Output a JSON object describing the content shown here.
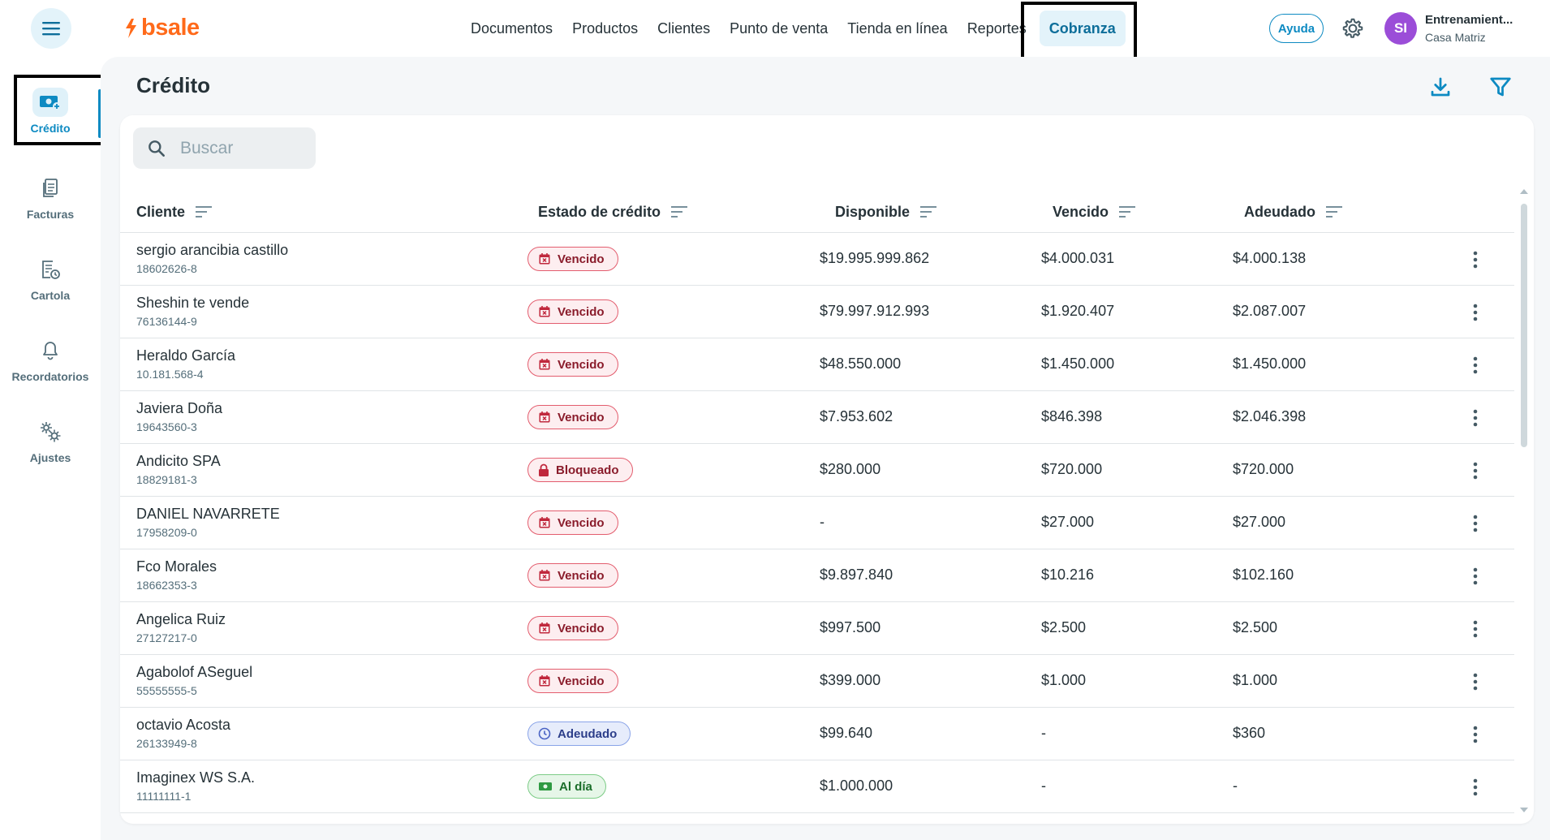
{
  "nav": {
    "logo_text": "bsale",
    "items": [
      {
        "label": "Documentos"
      },
      {
        "label": "Productos"
      },
      {
        "label": "Clientes"
      },
      {
        "label": "Punto de venta"
      },
      {
        "label": "Tienda en línea"
      },
      {
        "label": "Reportes"
      },
      {
        "label": "Cobranza",
        "active": true
      }
    ],
    "help_label": "Ayuda",
    "user": {
      "initials": "SI",
      "name": "Entrenamient...",
      "branch": "Casa Matriz"
    }
  },
  "sidebar": {
    "items": [
      {
        "label": "Crédito",
        "icon": "money-icon",
        "active": true
      },
      {
        "label": "Facturas",
        "icon": "document-icon"
      },
      {
        "label": "Cartola",
        "icon": "statement-icon"
      },
      {
        "label": "Recordatorios",
        "icon": "bell-icon"
      },
      {
        "label": "Ajustes",
        "icon": "settings-gears-icon"
      }
    ]
  },
  "page": {
    "title": "Crédito",
    "search_placeholder": "Buscar"
  },
  "table": {
    "columns": [
      "Cliente",
      "Estado de crédito",
      "Disponible",
      "Vencido",
      "Adeudado"
    ],
    "rows": [
      {
        "name": "sergio arancibia castillo",
        "rut": "18602626-8",
        "status": "Vencido",
        "status_type": "vencido",
        "disponible": "$19.995.999.862",
        "vencido": "$4.000.031",
        "adeudado": "$4.000.138"
      },
      {
        "name": "Sheshin te vende",
        "rut": "76136144-9",
        "status": "Vencido",
        "status_type": "vencido",
        "disponible": "$79.997.912.993",
        "vencido": "$1.920.407",
        "adeudado": "$2.087.007"
      },
      {
        "name": "Heraldo García",
        "rut": "10.181.568-4",
        "status": "Vencido",
        "status_type": "vencido",
        "disponible": "$48.550.000",
        "vencido": "$1.450.000",
        "adeudado": "$1.450.000"
      },
      {
        "name": "Javiera Doña",
        "rut": "19643560-3",
        "status": "Vencido",
        "status_type": "vencido",
        "disponible": "$7.953.602",
        "vencido": "$846.398",
        "adeudado": "$2.046.398"
      },
      {
        "name": "Andicito SPA",
        "rut": "18829181-3",
        "status": "Bloqueado",
        "status_type": "bloqueado",
        "disponible": "$280.000",
        "vencido": "$720.000",
        "adeudado": "$720.000"
      },
      {
        "name": "DANIEL NAVARRETE",
        "rut": "17958209-0",
        "status": "Vencido",
        "status_type": "vencido",
        "disponible": "-",
        "vencido": "$27.000",
        "adeudado": "$27.000"
      },
      {
        "name": "Fco Morales",
        "rut": "18662353-3",
        "status": "Vencido",
        "status_type": "vencido",
        "disponible": "$9.897.840",
        "vencido": "$10.216",
        "adeudado": "$102.160"
      },
      {
        "name": "Angelica Ruiz",
        "rut": "27127217-0",
        "status": "Vencido",
        "status_type": "vencido",
        "disponible": "$997.500",
        "vencido": "$2.500",
        "adeudado": "$2.500"
      },
      {
        "name": "Agabolof ASeguel",
        "rut": "55555555-5",
        "status": "Vencido",
        "status_type": "vencido",
        "disponible": "$399.000",
        "vencido": "$1.000",
        "adeudado": "$1.000"
      },
      {
        "name": "octavio Acosta",
        "rut": "26133949-8",
        "status": "Adeudado",
        "status_type": "adeudado",
        "disponible": "$99.640",
        "vencido": "-",
        "adeudado": "$360"
      },
      {
        "name": "Imaginex WS S.A.",
        "rut": "11111111-1",
        "status": "Al día",
        "status_type": "aldia",
        "disponible": "$1.000.000",
        "vencido": "-",
        "adeudado": "-"
      }
    ]
  },
  "colors": {
    "accent": "#0d8ac2",
    "brand": "#ff6a1a",
    "danger": "#e35d6e",
    "info": "#8aa4e8",
    "success": "#7ccc86"
  }
}
